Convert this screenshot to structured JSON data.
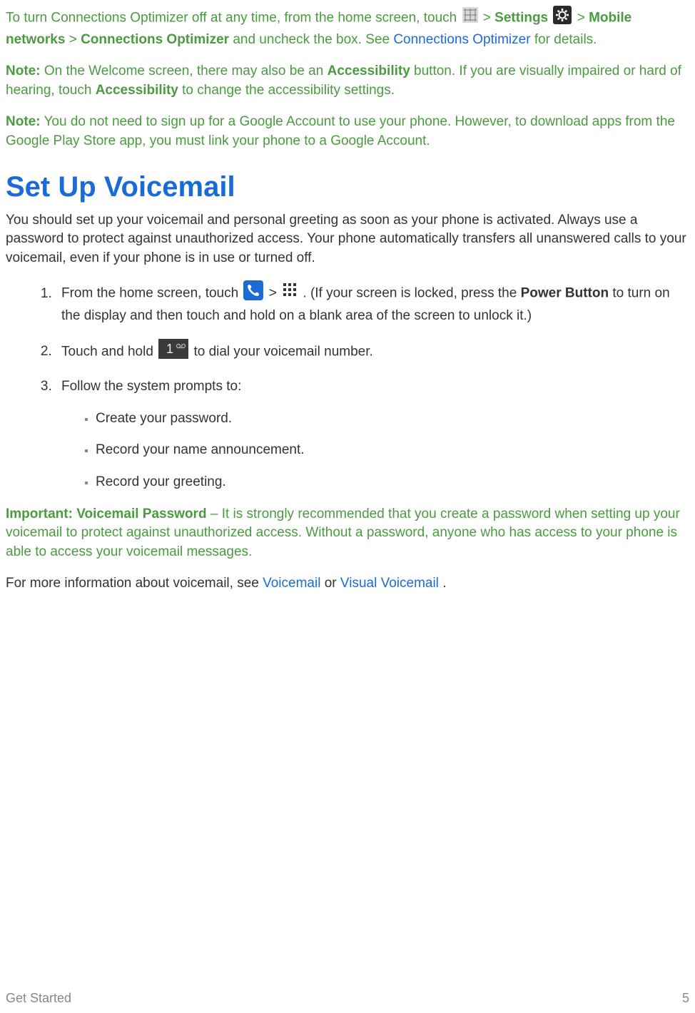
{
  "p1": {
    "t1": "To turn Connections Optimizer off at any time, from the home screen, touch ",
    "sep1": " > ",
    "settings": "Settings",
    "sep2": " > ",
    "mobile": "Mobile networks",
    "sep3": " > ",
    "conn": "Connections Optimizer",
    "t2": " and uncheck the box. See ",
    "link": "Connections Optimizer",
    "t3": " for details."
  },
  "note1": {
    "label": "Note:",
    "t1": " On the Welcome screen, there may also be an ",
    "acc1": "Accessibility",
    "t2": " button. If you are visually impaired or hard of hearing, touch ",
    "acc2": "Accessibility",
    "t3": " to change the accessibility settings."
  },
  "note2": {
    "label": "Note:",
    "t1": " You do not need to sign up for a Google Account to use your phone. However, to download apps from the Google Play Store app, you must link your phone to a Google Account."
  },
  "heading": "Set Up Voicemail",
  "intro": "You should set up your voicemail and personal greeting as soon as your phone is activated. Always use a password to protect against unauthorized access. Your phone automatically transfers all unanswered calls to your voicemail, even if your phone is in use or turned off.",
  "step1": {
    "t1": "From the home screen, touch ",
    "sep": " > ",
    "t2": ". (If your screen is locked, press the ",
    "pb": "Power Button",
    "t3": " to turn on the display and then touch and hold on a blank area of the screen to unlock it.)"
  },
  "step2": {
    "t1": "Touch and hold ",
    "t2": " to dial your voicemail number."
  },
  "step3": {
    "t1": "Follow the system prompts to:",
    "b1": "Create your password.",
    "b2": "Record your name announcement.",
    "b3": "Record your greeting."
  },
  "important": {
    "label": "Important:",
    "vp": " Voicemail Password",
    "t1": " – It is strongly recommended that you create a password when setting up your voicemail to protect against unauthorized access. Without a password, anyone who has access to your phone is able to access your voicemail messages."
  },
  "more": {
    "t1": "For more information about voicemail, see ",
    "l1": "Voicemail",
    "t2": " or ",
    "l2": "Visual Voicemail",
    "t3": "."
  },
  "footer": {
    "left": "Get Started",
    "right": "5"
  }
}
